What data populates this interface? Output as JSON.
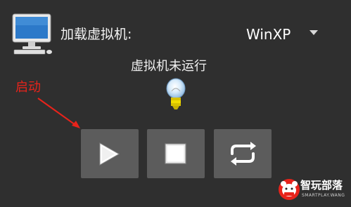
{
  "header": {
    "load_label": "加载虚拟机:",
    "selected_vm": "WinXP"
  },
  "status": {
    "text": "虚拟机未运行"
  },
  "annotation": {
    "start_label": "启动"
  },
  "controls": {
    "play_icon": "play-icon",
    "stop_icon": "stop-icon",
    "restart_icon": "restart-icon"
  },
  "watermark": {
    "brand": "智玩部落",
    "sub": "SMARTPLAY.WANG"
  },
  "colors": {
    "background": "#2f2f2f",
    "button_bg": "#5c5c5c",
    "annotation_red": "#e8231b"
  }
}
